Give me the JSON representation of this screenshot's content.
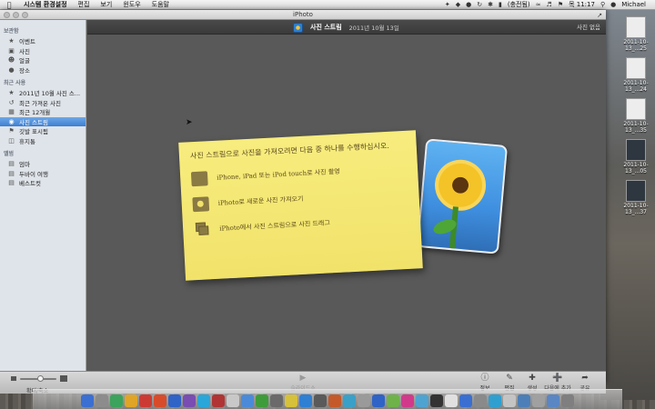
{
  "menubar": {
    "apple": "",
    "items": [
      "시스템 환경설정",
      "편집",
      "보기",
      "윈도우",
      "도움말"
    ],
    "battery": "(충전됨)",
    "clock": "목 11:17",
    "user": "Michael"
  },
  "window": {
    "title": "iPhoto",
    "sidebar": {
      "sections": [
        {
          "header": "보관함",
          "items": [
            {
              "label": "이벤트",
              "icon": "events-icon"
            },
            {
              "label": "사진",
              "icon": "photos-icon"
            },
            {
              "label": "얼굴",
              "icon": "faces-icon"
            },
            {
              "label": "장소",
              "icon": "places-icon"
            }
          ]
        },
        {
          "header": "최근 사용",
          "items": [
            {
              "label": "2011년 10월 사진 스...",
              "icon": "event-icon"
            },
            {
              "label": "최근 가져온 사진",
              "icon": "import-icon"
            },
            {
              "label": "최근 12개월",
              "icon": "calendar-icon"
            },
            {
              "label": "사진 스트림",
              "icon": "photo-stream-icon",
              "selected": true
            },
            {
              "label": "깃발 표시됨",
              "icon": "flag-icon"
            },
            {
              "label": "휴지통",
              "icon": "trash-icon"
            }
          ]
        },
        {
          "header": "앨범",
          "items": [
            {
              "label": "엄마",
              "icon": "album-icon"
            },
            {
              "label": "두바이 여행",
              "icon": "album-icon"
            },
            {
              "label": "베스트컷",
              "icon": "album-icon"
            }
          ]
        }
      ]
    },
    "content_header": {
      "title": "사진 스트림",
      "date": "2011년 10월 13일",
      "right": "사진 없음"
    },
    "note": {
      "lead": "사진 스트림으로 사진을 가져오려면 다음 중 하나를 수행하십시오.",
      "rows": [
        "iPhone, iPad 또는 iPod touch로 사진 촬영",
        "iPhoto로 새로운 사진 가져오기",
        "iPhoto에서 사진 스트림으로 사진 드래그"
      ]
    },
    "toolbar": {
      "zoom_label": "확대/축소",
      "slideshow_label": "슬라이드쇼",
      "tools": [
        {
          "label": "정보",
          "icon": "info-icon"
        },
        {
          "label": "편집",
          "icon": "edit-icon"
        },
        {
          "label": "생성",
          "icon": "create-icon"
        },
        {
          "label": "다음에 추가",
          "icon": "add-to-icon"
        },
        {
          "label": "공유",
          "icon": "share-icon"
        }
      ],
      "zoom_level": 0.55
    }
  },
  "desktop_icons": [
    {
      "label": "2011-10-13_...25"
    },
    {
      "label": "2011-10-13_...24"
    },
    {
      "label": "2011-10-13_...35"
    },
    {
      "label": "2011-10-13_...05"
    },
    {
      "label": "2011-10-13_...37"
    }
  ],
  "dock_colors": [
    "#3b6fd1",
    "#8c8c8c",
    "#3ba35b",
    "#e0a527",
    "#cc3b33",
    "#d84b2a",
    "#2f63c6",
    "#7a4db2",
    "#2aa6d9",
    "#b03434",
    "#c8c8c8",
    "#4b8ad8",
    "#3f9c3a",
    "#6a6a6a",
    "#d6c13a",
    "#2f7fd3",
    "#5a5a5a",
    "#c45a2a",
    "#3aa0c8",
    "#9a9a9a",
    "#2f63c6",
    "#6fb24a",
    "#d13a8a",
    "#4fa3d1",
    "#333333",
    "#e0e0e0",
    "#3a6fd1",
    "#8a8a8a",
    "#2f9fd0",
    "#c4c4c4",
    "#4c7fb8",
    "#a0a0a0",
    "#5a86c4",
    "#7f7f7f"
  ]
}
